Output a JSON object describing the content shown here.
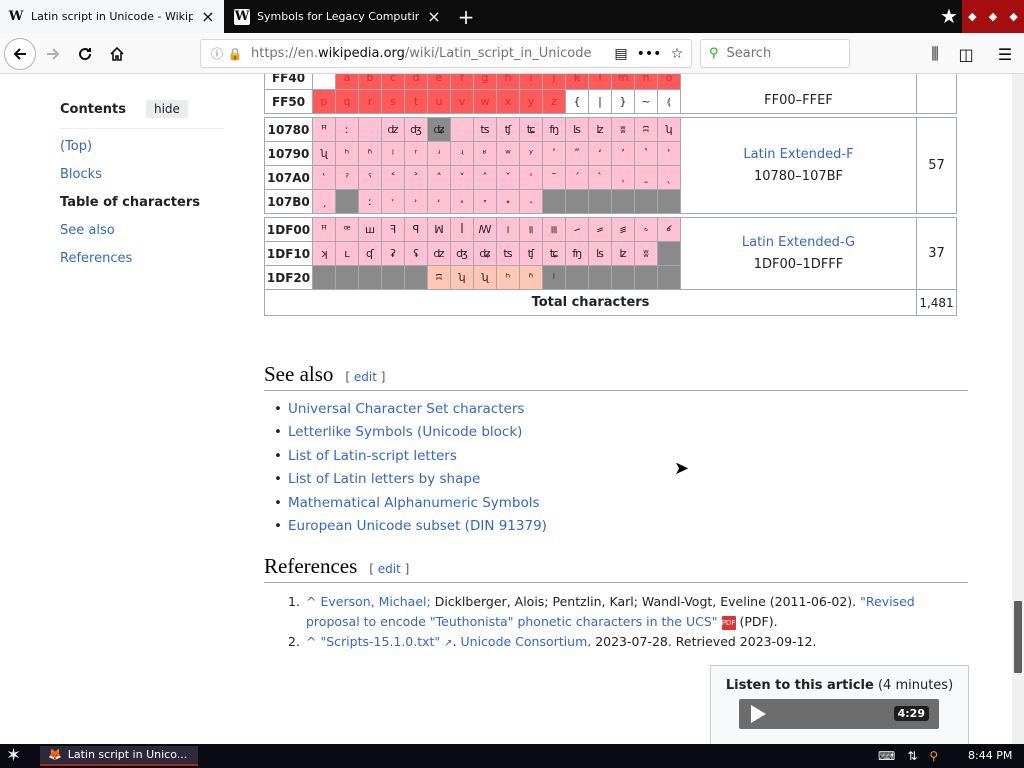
{
  "browser": {
    "tabs": [
      {
        "title": "Latin script in Unicode - Wikipedia",
        "favicon": "W"
      },
      {
        "title": "Symbols for Legacy Computing - W",
        "favicon": "W"
      }
    ],
    "new_tab_label": "+",
    "url_prefix": "https://en.",
    "url_domain": "wikipedia.org",
    "url_path": "/wiki/Latin_script_in_Unicode",
    "search_placeholder": "Search"
  },
  "toc": {
    "title": "Contents",
    "hide_label": "hide",
    "items": [
      "(Top)",
      "Blocks",
      "Table of characters",
      "See also",
      "References"
    ],
    "current": "Table of characters"
  },
  "table": {
    "rows": [
      {
        "header": "FF40",
        "cells": [
          "",
          "a",
          "b",
          "c",
          "d",
          "e",
          "f",
          "g",
          "h",
          "i",
          "j",
          "k",
          "l",
          "m",
          "n",
          "o"
        ],
        "colors": "wrrrrrrrrrrrrrrr"
      },
      {
        "header": "FF50",
        "cells": [
          "p",
          "q",
          "r",
          "s",
          "t",
          "u",
          "v",
          "w",
          "x",
          "y",
          "z",
          "{",
          "|",
          "}",
          "~",
          "⦅"
        ],
        "colors": "rrrrrrrrrrrwwwww"
      },
      {
        "header": "10780",
        "cells": [
          "ꟸ",
          "ː",
          "",
          "ʣ",
          "ʤ",
          "ʥ",
          "",
          "ʦ",
          "ʧ",
          "ʨ",
          "ʩ",
          "ʪ",
          "ʫ",
          "ʬ",
          "ʭ",
          "ʮ"
        ],
        "colors": "pppppxpppppppppp"
      },
      {
        "header": "10790",
        "cells": [
          "ʯ",
          "ʰ",
          "ʱ",
          "ʲ",
          "ʳ",
          "ʴ",
          "ʵ",
          "ʶ",
          "ʷ",
          "ʸ",
          "ʹ",
          "ʺ",
          "ʻ",
          "ʼ",
          "ʽ",
          "ʾ"
        ],
        "colors": "pppppppppppppppp"
      },
      {
        "header": "107A0",
        "cells": [
          "ʿ",
          "ˀ",
          "ˁ",
          "˂",
          "˃",
          "˄",
          "˅",
          "ˆ",
          "ˇ",
          "ˈ",
          "ˉ",
          "ˊ",
          "ˋ",
          "ˌ",
          "ˍ",
          "ˎ"
        ],
        "colors": "pppppppppppppppp"
      },
      {
        "header": "107B0",
        "cells": [
          "ˏ",
          "",
          "ː",
          "ˑ",
          "˒",
          "˓",
          "˔",
          "˕",
          "˖",
          "˗",
          "",
          "",
          "",
          "",
          "",
          ""
        ],
        "colors": "pxppppppppxxxxxx"
      },
      {
        "header": "1DF00",
        "cells": [
          "ꟸ",
          "ꟹ",
          "ꟺ",
          "ꟻ",
          "ꟼ",
          "ꟽ",
          "ꟾ",
          "ꟿ",
          "꠰",
          "꠱",
          "꠲",
          "꠳",
          "꠴",
          "꠵",
          "꠶",
          "꠷"
        ],
        "colors": "pppppppppppppppp"
      },
      {
        "header": "1DF10",
        "cells": [
          "ʞ",
          "ʟ",
          "ʠ",
          "ʡ",
          "ʢ",
          "ʣ",
          "ʤ",
          "ʥ",
          "ʦ",
          "ʧ",
          "ʨ",
          "ʩ",
          "ʪ",
          "ʫ",
          "ʬ",
          ""
        ],
        "colors": "pppppppppppppppx"
      },
      {
        "header": "1DF20",
        "cells": [
          "",
          "",
          "",
          "",
          "",
          "ʭ",
          "ʮ",
          "ʯ",
          "ʰ",
          "ʱ",
          "ʲ",
          "",
          "",
          "",
          "",
          ""
        ],
        "colors": "xxxxxoooooxxxxxx"
      }
    ],
    "blocks": [
      {
        "name": "",
        "range": "FF00–FFEF",
        "count": ""
      },
      {
        "name": "Latin Extended-F",
        "range": "10780–107BF",
        "count": "57"
      },
      {
        "name": "Latin Extended-G",
        "range": "1DF00–1DFFF",
        "count": "37"
      }
    ],
    "total_label": "Total characters",
    "total_value": "1,481"
  },
  "see_also": {
    "heading": "See also",
    "edit_label": "edit",
    "items": [
      "Universal Character Set characters",
      "Letterlike Symbols (Unicode block)",
      "List of Latin-script letters",
      "List of Latin letters by shape",
      "Mathematical Alphanumeric Symbols",
      "European Unicode subset (DIN 91379)"
    ]
  },
  "references": {
    "heading": "References",
    "edit_label": "edit",
    "items": [
      {
        "num": "1.",
        "caret": "^",
        "author_link": "Everson, Michael;",
        "authors": "Dicklberger, Alois; Pentzlin, Karl; Wandl-Vogt, Eveline (2011-06-02).",
        "title": "\"Revised proposal to encode \"Teuthonista\" phonetic characters in the UCS\"",
        "suffix": "(PDF)."
      },
      {
        "num": "2.",
        "caret": "^",
        "title": "\"Scripts-15.1.0.txt\"",
        "publisher": "Unicode Consortium",
        "suffix": "2023-07-28. Retrieved 2023-09-12."
      }
    ]
  },
  "listen": {
    "label": "Listen to this article",
    "duration_note": "(4 minutes)",
    "time": "4:29"
  },
  "taskbar": {
    "task_label": "Latin script in Unico...",
    "clock": "8:44 PM"
  }
}
